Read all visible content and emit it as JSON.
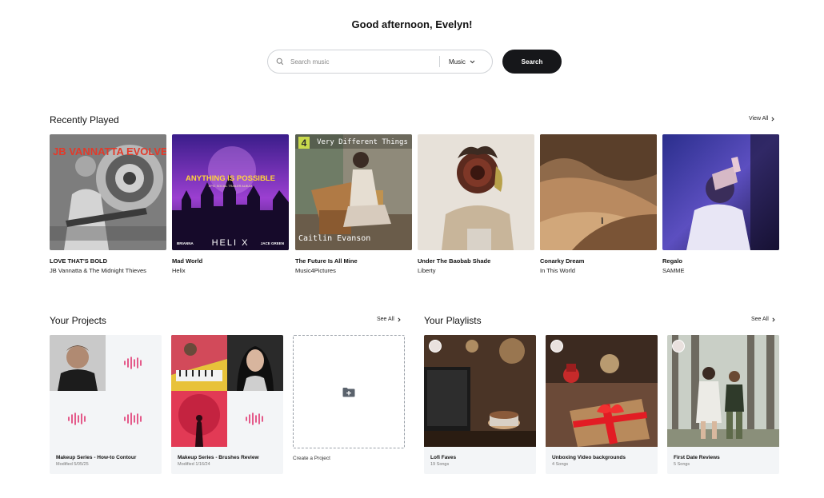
{
  "header": {
    "greeting": "Good afternoon, Evelyn!",
    "search_placeholder": "Search music",
    "filter_label": "Music",
    "search_button": "Search"
  },
  "recently_played": {
    "title": "Recently Played",
    "view_all": "View All",
    "items": [
      {
        "title": "LOVE THAT'S BOLD",
        "artist": "JB Vannatta & The Midnight Thieves",
        "cover_text_top": "JB VANNATTA   EVOLVED"
      },
      {
        "title": "Mad World",
        "artist": "Helix",
        "cover_text_main": "ANYTHING IS POSSIBLE",
        "cover_text_sub": "EPIC SOCIAL TRAILER ALBUM",
        "cover_text_left": "BRIANNA",
        "cover_text_center": "HELI X",
        "cover_text_right": "JACE GREEN"
      },
      {
        "title": "The Future Is All Mine",
        "artist": "Music4Pictures",
        "cover_text_top": "Very Different Things",
        "cover_badge": "4",
        "cover_text_bottom": "Caitlin Evanson"
      },
      {
        "title": "Under The Baobab Shade",
        "artist": "Liberty"
      },
      {
        "title": "Conarky Dream",
        "artist": "In This World"
      },
      {
        "title": "Regalo",
        "artist": "SAMME"
      }
    ]
  },
  "projects": {
    "title": "Your Projects",
    "see_all": "See All",
    "items": [
      {
        "title": "Makeup Series - How-to Contour",
        "modified": "Modified 5/05/25"
      },
      {
        "title": "Makeup Series - Brushes Review",
        "modified": "Modified 1/16/24"
      }
    ],
    "create_label": "Create a Project"
  },
  "playlists": {
    "title": "Your Playlists",
    "see_all": "See All",
    "items": [
      {
        "title": "Lofi Faves",
        "count": "19 Songs"
      },
      {
        "title": "Unboxing Video backgrounds",
        "count": "4 Songs"
      },
      {
        "title": "First Date Reviews",
        "count": "5 Songs"
      }
    ]
  },
  "colors": {
    "accent_pink": "#e0336e",
    "dark_button": "#16171a",
    "card_bg": "#f3f5f7"
  }
}
